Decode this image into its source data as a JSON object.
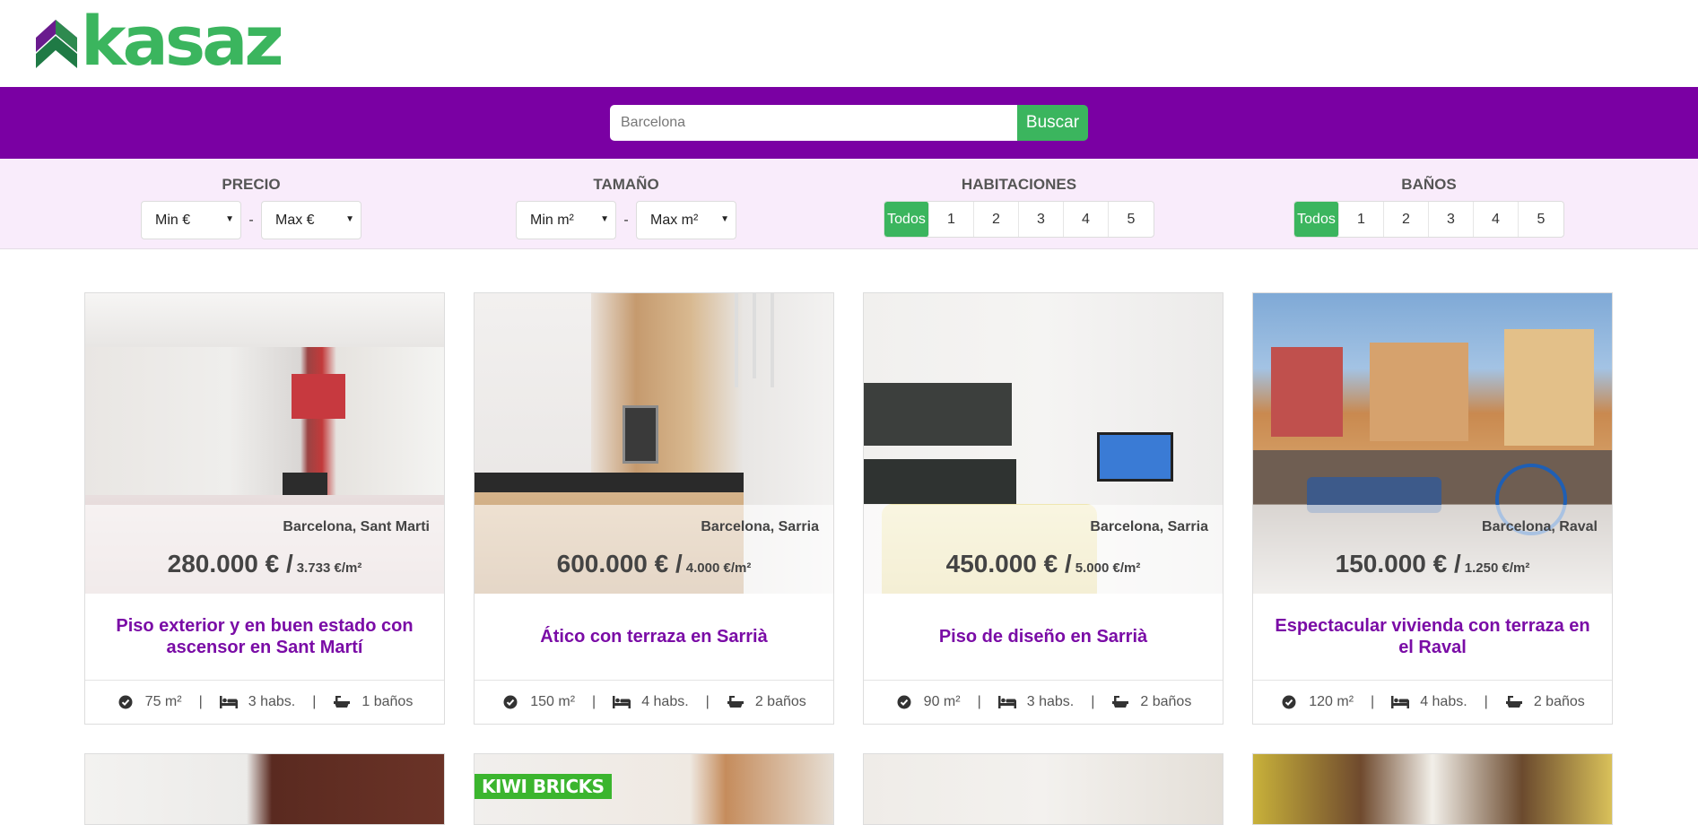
{
  "brand": {
    "name": "kasaz",
    "primary_color": "#7a00a3",
    "accent_color": "#3bb55e"
  },
  "search": {
    "value": "Barcelona",
    "button_label": "Buscar"
  },
  "filters": {
    "precio": {
      "label": "PRECIO",
      "min": "Min €",
      "max": "Max €",
      "separator": "-"
    },
    "tamano": {
      "label": "TAMAÑO",
      "min": "Min m²",
      "max": "Max m²",
      "separator": "-"
    },
    "habitaciones": {
      "label": "HABITACIONES",
      "options": [
        "Todos",
        "1",
        "2",
        "3",
        "4",
        "5"
      ],
      "selected": "Todos"
    },
    "banos": {
      "label": "BAÑOS",
      "options": [
        "Todos",
        "1",
        "2",
        "3",
        "4",
        "5"
      ],
      "selected": "Todos"
    }
  },
  "listings": [
    {
      "location": "Barcelona, Sant Marti",
      "price": "280.000 € /",
      "price_m2": "3.733 €/m²",
      "title": "Piso exterior y en buen estado con ascensor en Sant Martí",
      "size": "75 m²",
      "rooms": "3 habs.",
      "baths": "1 baños",
      "separator": "|"
    },
    {
      "location": "Barcelona, Sarria",
      "price": "600.000 € /",
      "price_m2": "4.000 €/m²",
      "title": "Ático con terraza en Sarrià",
      "size": "150 m²",
      "rooms": "4 habs.",
      "baths": "2 baños",
      "separator": "|"
    },
    {
      "location": "Barcelona, Sarria",
      "price": "450.000 € /",
      "price_m2": "5.000 €/m²",
      "title": "Piso de diseño en Sarrià",
      "size": "90 m²",
      "rooms": "3 habs.",
      "baths": "2 baños",
      "separator": "|"
    },
    {
      "location": "Barcelona, Raval",
      "price": "150.000 € /",
      "price_m2": "1.250 €/m²",
      "title": "Espectacular vivienda con terraza en el Raval",
      "size": "120 m²",
      "rooms": "4 habs.",
      "baths": "2 baños",
      "separator": "|"
    }
  ],
  "partial_listings": {
    "kiwi_badge": "KIWI BRICKS"
  }
}
